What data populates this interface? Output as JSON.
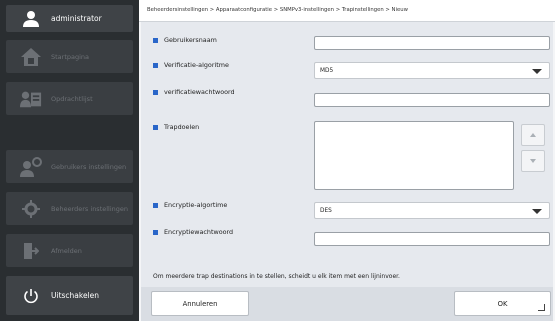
{
  "sidebar": {
    "user": {
      "label": "administrator",
      "icon": "user-icon"
    },
    "items": [
      {
        "label": "Startpagina",
        "icon": "home-icon"
      },
      {
        "label": "Opdrachtlijst",
        "icon": "job-list-icon"
      },
      {
        "label": "Gebruikers instellingen",
        "icon": "user-settings-icon"
      },
      {
        "label": "Beheerders instellingen",
        "icon": "gear-icon"
      },
      {
        "label": "Afmelden",
        "icon": "logout-icon"
      }
    ],
    "power": {
      "label": "Uitschakelen",
      "icon": "power-icon"
    }
  },
  "breadcrumb": "Beheerdersinstellingen > Apparaatconfiguratie > SNMPv3-instellingen > Trapinstellingen > Nieuw",
  "form": {
    "username_label": "Gebruikersnaam",
    "username_value": "",
    "auth_algorithm_label": "Verificatie-algoritme",
    "auth_algorithm_value": "MD5",
    "auth_password_label": "verificatiewachtwoord",
    "auth_password_value": "",
    "trap_targets_label": "Trapdoelen",
    "trap_targets_value": "",
    "encryption_algorithm_label": "Encryptie-algortime",
    "encryption_algorithm_value": "DES",
    "encryption_password_label": "Encryptiewachtwoord",
    "encryption_password_value": "",
    "hint": "Om meerdere trap destinations in te stellen, scheidt u elk item met een lijninvoer."
  },
  "footer": {
    "cancel_label": "Annuleren",
    "ok_label": "OK"
  },
  "colors": {
    "sidebar_bg": "#2a2e31",
    "accent_square": "#2a66c9",
    "content_bg": "#e6e9ee"
  }
}
